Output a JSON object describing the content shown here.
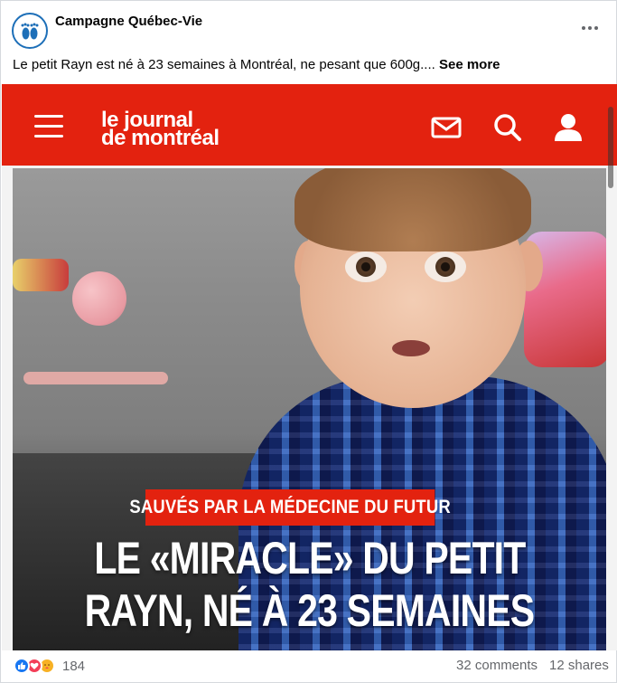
{
  "post": {
    "page_name": "Campagne Québec-Vie",
    "caption": "Le petit Rayn est né à 23 semaines à Montréal, ne pesant que 600g....",
    "see_more": "See more"
  },
  "media": {
    "site_logo_line1": "le journal",
    "site_logo_line2": "de montréal",
    "label": "SAUVÉS PAR LA MÉDECINE DU FUTUR",
    "headline_line1": "LE «MIRACLE» DU PETIT",
    "headline_line2": "RAYN, NÉ À 23 SEMAINES",
    "icons": [
      "menu-icon",
      "mail-icon",
      "search-icon",
      "user-icon"
    ]
  },
  "footer": {
    "reaction_count": "184",
    "comments": "32 comments",
    "shares": "12 shares",
    "reaction_icons": [
      "like-icon",
      "love-icon",
      "care-icon"
    ]
  },
  "colors": {
    "brand_red": "#e3220f",
    "facebook_blue": "#1877f2",
    "meta_text": "#65676b"
  }
}
